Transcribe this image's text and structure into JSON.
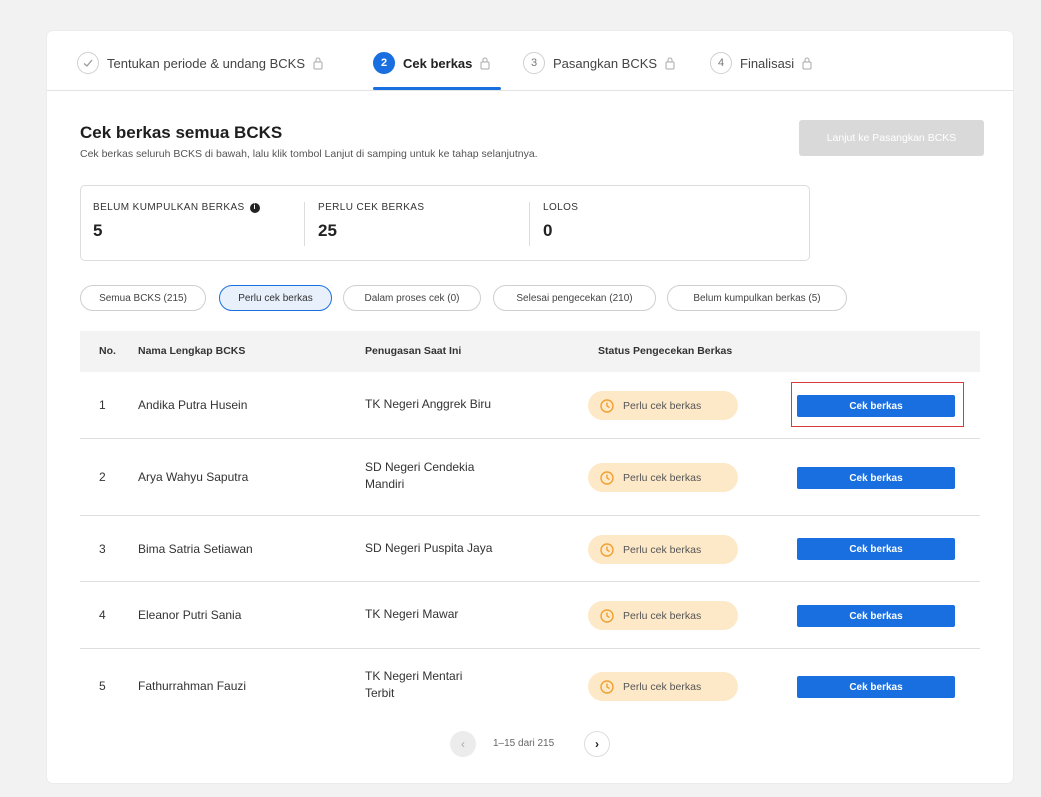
{
  "stepper": {
    "steps": [
      {
        "number": "✓",
        "label": "Tentukan periode & undang BCKS",
        "state": "done",
        "locked": true
      },
      {
        "number": "2",
        "label": "Cek berkas",
        "state": "active",
        "locked": true
      },
      {
        "number": "3",
        "label": "Pasangkan BCKS",
        "state": "pending",
        "locked": true
      },
      {
        "number": "4",
        "label": "Finalisasi",
        "state": "pending",
        "locked": true
      }
    ]
  },
  "header": {
    "title": "Cek berkas semua BCKS",
    "subtitle": "Cek berkas seluruh BCKS di bawah, lalu klik tombol Lanjut di samping untuk ke tahap selanjutnya.",
    "next_button": "Lanjut ke Pasangkan BCKS"
  },
  "stats": [
    {
      "label": "BELUM KUMPULKAN BERKAS",
      "value": "5",
      "info": true
    },
    {
      "label": "PERLU CEK BERKAS",
      "value": "25"
    },
    {
      "label": "LOLOS",
      "value": "0"
    }
  ],
  "filters": [
    {
      "label": "Semua BCKS (215)",
      "selected": false
    },
    {
      "label": "Perlu cek berkas",
      "selected": true
    },
    {
      "label": "Dalam proses cek (0)",
      "selected": false
    },
    {
      "label": "Selesai pengecekan (210)",
      "selected": false
    },
    {
      "label": "Belum kumpulkan berkas (5)",
      "selected": false
    }
  ],
  "table": {
    "headers": [
      "No.",
      "Nama Lengkap BCKS",
      "Penugasan Saat Ini",
      "Status Pengecekan Berkas"
    ],
    "rows": [
      {
        "no": "1",
        "name": "Andika Putra Husein",
        "school": "TK Negeri Anggrek Biru",
        "status": "Perlu cek berkas",
        "action": "Cek berkas"
      },
      {
        "no": "2",
        "name": "Arya Wahyu Saputra",
        "school": "SD Negeri Cendekia Mandiri",
        "status": "Perlu cek berkas",
        "action": "Cek berkas"
      },
      {
        "no": "3",
        "name": "Bima Satria Setiawan",
        "school": "SD Negeri Puspita Jaya",
        "status": "Perlu cek berkas",
        "action": "Cek berkas"
      },
      {
        "no": "4",
        "name": "Eleanor Putri Sania",
        "school": "TK Negeri Mawar",
        "status": "Perlu cek berkas",
        "action": "Cek berkas"
      },
      {
        "no": "5",
        "name": "Fathurrahman Fauzi",
        "school": "TK Negeri Mentari Terbit",
        "status": "Perlu cek berkas",
        "action": "Cek berkas"
      }
    ]
  },
  "pagination": {
    "prev_icon": "‹",
    "next_icon": "›",
    "text": "1–15 dari 215"
  },
  "colors": {
    "primary": "#1a6fe0",
    "status_bg": "#fde9c8",
    "status_icon": "#f0a030",
    "highlight": "#d93a3a"
  }
}
